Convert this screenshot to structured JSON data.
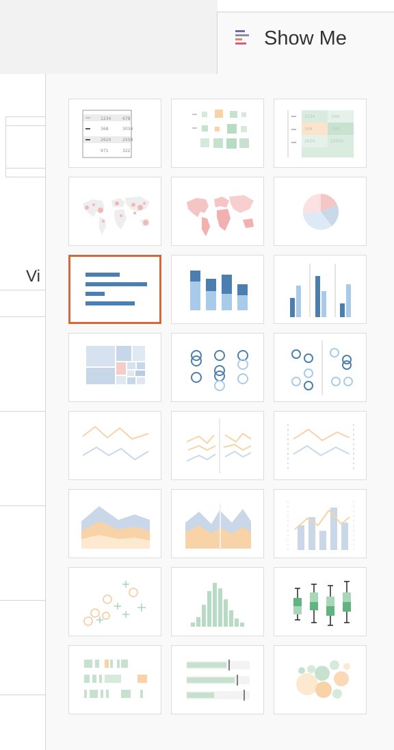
{
  "show_me": {
    "label": "Show Me",
    "icon": "show-me-bars-icon"
  },
  "partial_label": "Vi",
  "chart_options": [
    {
      "id": "text-table",
      "icon": "text-table-icon",
      "cells": [
        "1234",
        "678",
        "368",
        "3034",
        "2620",
        "2559",
        "971",
        "322"
      ]
    },
    {
      "id": "heat-map",
      "icon": "heat-map-icon"
    },
    {
      "id": "highlight-table",
      "icon": "highlight-table-icon",
      "cells": [
        "1234",
        "540",
        "368",
        "340",
        "2620",
        "12050"
      ]
    },
    {
      "id": "symbol-map",
      "icon": "symbol-map-icon"
    },
    {
      "id": "filled-map",
      "icon": "filled-map-icon"
    },
    {
      "id": "pie-chart",
      "icon": "pie-chart-icon"
    },
    {
      "id": "horizontal-bars",
      "icon": "horizontal-bars-icon",
      "selected": true
    },
    {
      "id": "stacked-bars",
      "icon": "stacked-bars-icon"
    },
    {
      "id": "side-by-side-bars",
      "icon": "side-by-side-bars-icon"
    },
    {
      "id": "treemap",
      "icon": "treemap-icon"
    },
    {
      "id": "circle-views",
      "icon": "circle-views-icon"
    },
    {
      "id": "side-by-side-circles",
      "icon": "side-by-side-circles-icon"
    },
    {
      "id": "continuous-lines",
      "icon": "continuous-lines-icon"
    },
    {
      "id": "discrete-lines",
      "icon": "discrete-lines-icon"
    },
    {
      "id": "dual-lines",
      "icon": "dual-lines-icon"
    },
    {
      "id": "continuous-area",
      "icon": "continuous-area-icon"
    },
    {
      "id": "discrete-area",
      "icon": "discrete-area-icon"
    },
    {
      "id": "dual-combination",
      "icon": "dual-combination-icon"
    },
    {
      "id": "scatter-plot",
      "icon": "scatter-plot-icon"
    },
    {
      "id": "histogram",
      "icon": "histogram-icon"
    },
    {
      "id": "box-and-whisker",
      "icon": "box-and-whisker-icon"
    },
    {
      "id": "gantt-chart",
      "icon": "gantt-chart-icon"
    },
    {
      "id": "bullet-graph",
      "icon": "bullet-graph-icon"
    },
    {
      "id": "packed-bubbles",
      "icon": "packed-bubbles-icon"
    }
  ],
  "colors": {
    "selected_border": "#d2693b",
    "blue_dark": "#4a7fb0",
    "blue_light": "#a9cbea",
    "orange_light": "#f8d3a8",
    "green": "#5fb47f",
    "pink": "#f2b8b8"
  }
}
